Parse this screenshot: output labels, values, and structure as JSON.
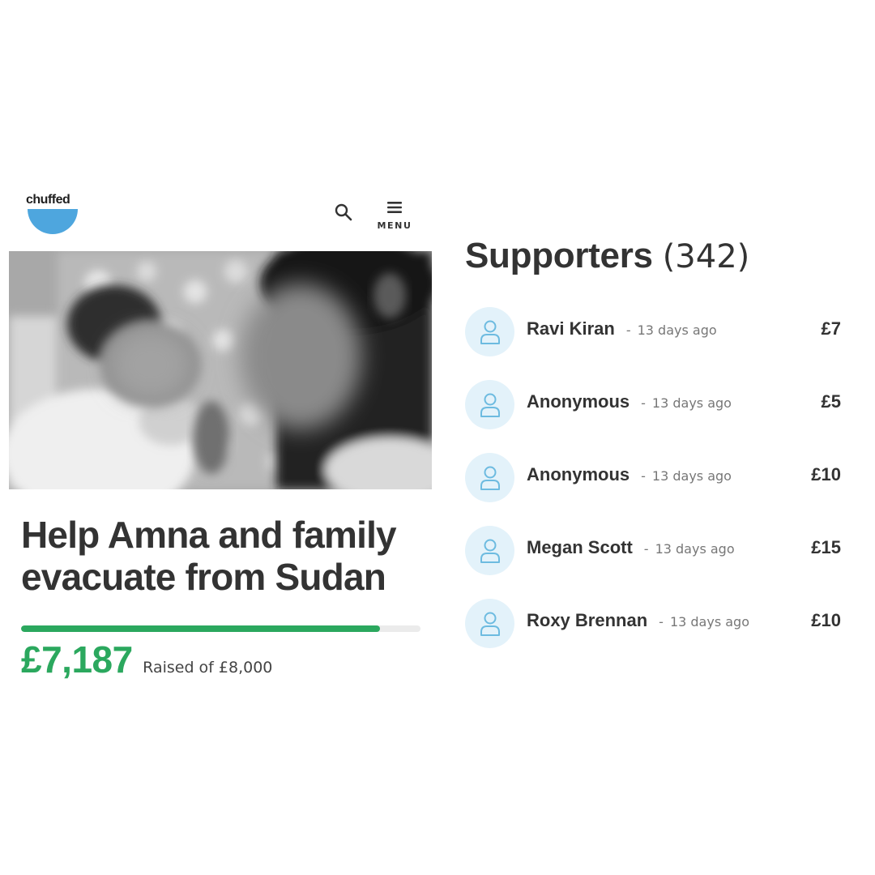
{
  "brand": {
    "logo_text": "chuffed",
    "logo_icon": "bowl-logo-icon",
    "logo_color": "#4ea6de"
  },
  "header": {
    "search_icon": "search-icon",
    "menu_icon": "hamburger-icon",
    "menu_label": "MENU"
  },
  "campaign": {
    "title": "Help Amna and family evacuate from Sudan",
    "photo": "blurred-black-and-white-photo-of-newborn-and-mother",
    "raised": "£7,187",
    "raised_of": "Raised of £8,000",
    "progress_fraction": 0.898,
    "progress_color": "#2ba85e"
  },
  "supporters": {
    "title": "Supporters",
    "count": "(342)",
    "avatar_icon": "user-icon",
    "separator": "-",
    "items": [
      {
        "name": "Ravi Kiran",
        "time": "13 days ago",
        "amount": "£7"
      },
      {
        "name": "Anonymous",
        "time": "13 days ago",
        "amount": "£5"
      },
      {
        "name": "Anonymous",
        "time": "13 days ago",
        "amount": "£10"
      },
      {
        "name": "Megan Scott",
        "time": "13 days ago",
        "amount": "£15"
      },
      {
        "name": "Roxy Brennan",
        "time": "13 days ago",
        "amount": "£10"
      }
    ]
  }
}
